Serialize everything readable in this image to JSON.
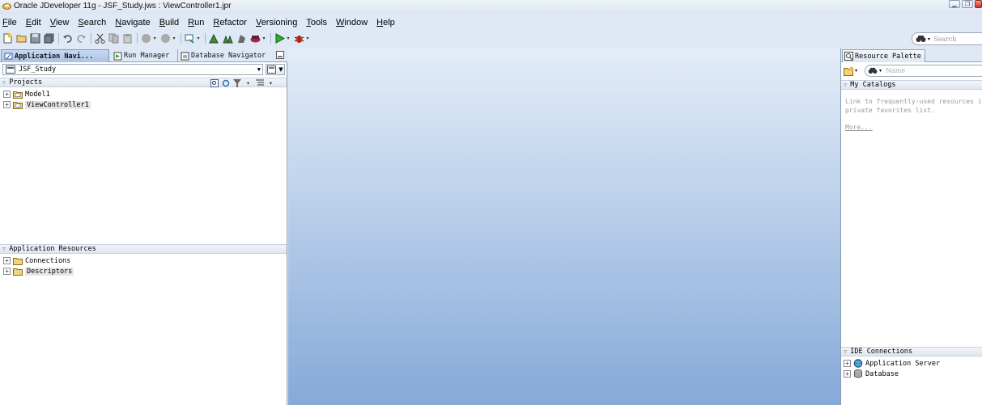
{
  "window": {
    "title": "Oracle JDeveloper 11g - JSF_Study.jws : ViewController1.jpr"
  },
  "menu": [
    "File",
    "Edit",
    "View",
    "Search",
    "Navigate",
    "Build",
    "Run",
    "Refactor",
    "Versioning",
    "Tools",
    "Window",
    "Help"
  ],
  "toolbar": {
    "search_placeholder": "Search"
  },
  "left_panel": {
    "tabs": [
      "Application Navi...",
      "Run Manager",
      "Database Navigator"
    ],
    "application": "JSF_Study",
    "projects_header": "Projects",
    "projects": [
      "Model1",
      "ViewController1"
    ],
    "resources_header": "Application Resources",
    "resources": [
      "Connections",
      "Descriptors"
    ]
  },
  "right_panel": {
    "tab": "Resource Palette",
    "search_placeholder": "Name",
    "catalogs_header": "My Catalogs",
    "hint_line1": "Link to frequently-used resources in a",
    "hint_line2": "private favorites list.",
    "more_link": "More...",
    "ide_header": "IDE Connections",
    "ide_items": [
      "Application Server",
      "Database"
    ]
  },
  "colors": {
    "editor_top": "#e4edf8",
    "editor_bottom": "#86a9d8",
    "active_tab": "#a9c3e7"
  }
}
